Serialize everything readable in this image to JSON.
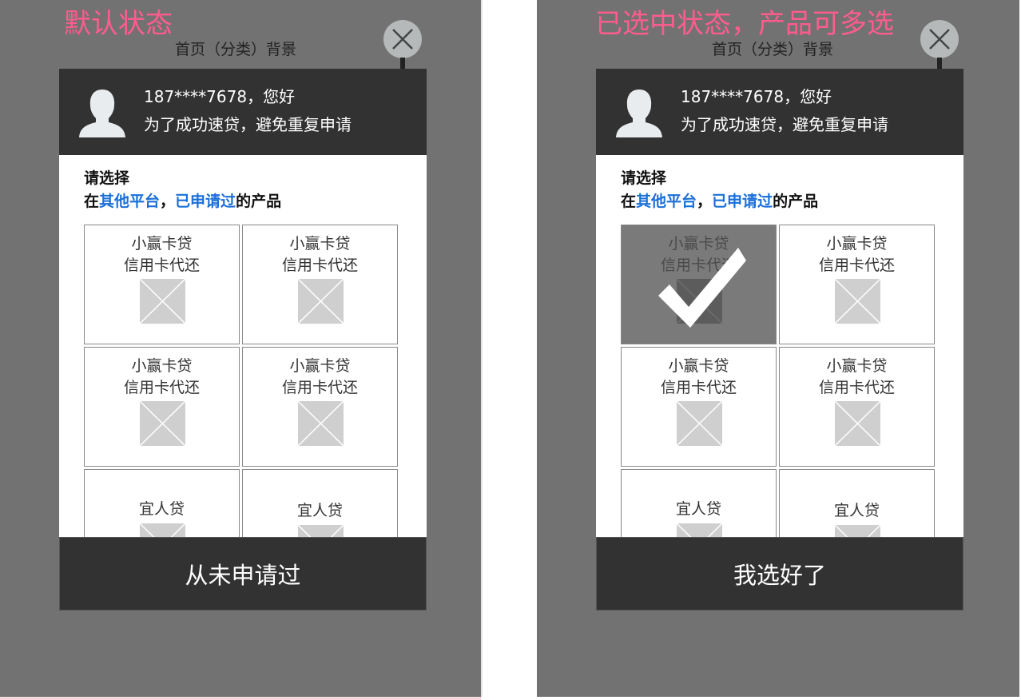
{
  "panels": [
    {
      "state_title": "默认状态",
      "background_label": "首页（分类）背景",
      "greeting": "187****7678，您好",
      "tip": "为了成功速贷，避免重复申请",
      "select_title": "请选择",
      "select_sub": {
        "p1": "在",
        "h1": "其他平台",
        "p2": "，",
        "h2": "已申请过",
        "p3": "的产品"
      },
      "products": [
        {
          "name": "小赢卡贷",
          "sub": "信用卡代还"
        },
        {
          "name": "小赢卡贷",
          "sub": "信用卡代还"
        },
        {
          "name": "小赢卡贷",
          "sub": "信用卡代还"
        },
        {
          "name": "小赢卡贷",
          "sub": "信用卡代还"
        },
        {
          "name": "宜人贷",
          "sub": ""
        },
        {
          "name": "宜人贷",
          "sub": ""
        }
      ],
      "button_label": "从未申请过"
    },
    {
      "state_title": "已选中状态，产品可多选",
      "background_label": "首页（分类）背景",
      "greeting": "187****7678，您好",
      "tip": "为了成功速贷，避免重复申请",
      "select_title": "请选择",
      "select_sub": {
        "p1": "在",
        "h1": "其他平台",
        "p2": "，",
        "h2": "已申请过",
        "p3": "的产品"
      },
      "products": [
        {
          "name": "小赢卡贷",
          "sub": "信用卡代还",
          "selected": true
        },
        {
          "name": "小赢卡贷",
          "sub": "信用卡代还"
        },
        {
          "name": "小赢卡贷",
          "sub": "信用卡代还"
        },
        {
          "name": "小赢卡贷",
          "sub": "信用卡代还"
        },
        {
          "name": "宜人贷",
          "sub": ""
        },
        {
          "name": "宜人贷",
          "sub": ""
        }
      ],
      "button_label": "我选好了"
    }
  ],
  "colors": {
    "state_title": "#ff5c8e",
    "highlight": "#1a6fd8",
    "dark_bar": "#323232",
    "backdrop": "#727272"
  },
  "icons": [
    "close-icon",
    "user-avatar-icon",
    "image-placeholder-icon",
    "checkmark-icon"
  ]
}
